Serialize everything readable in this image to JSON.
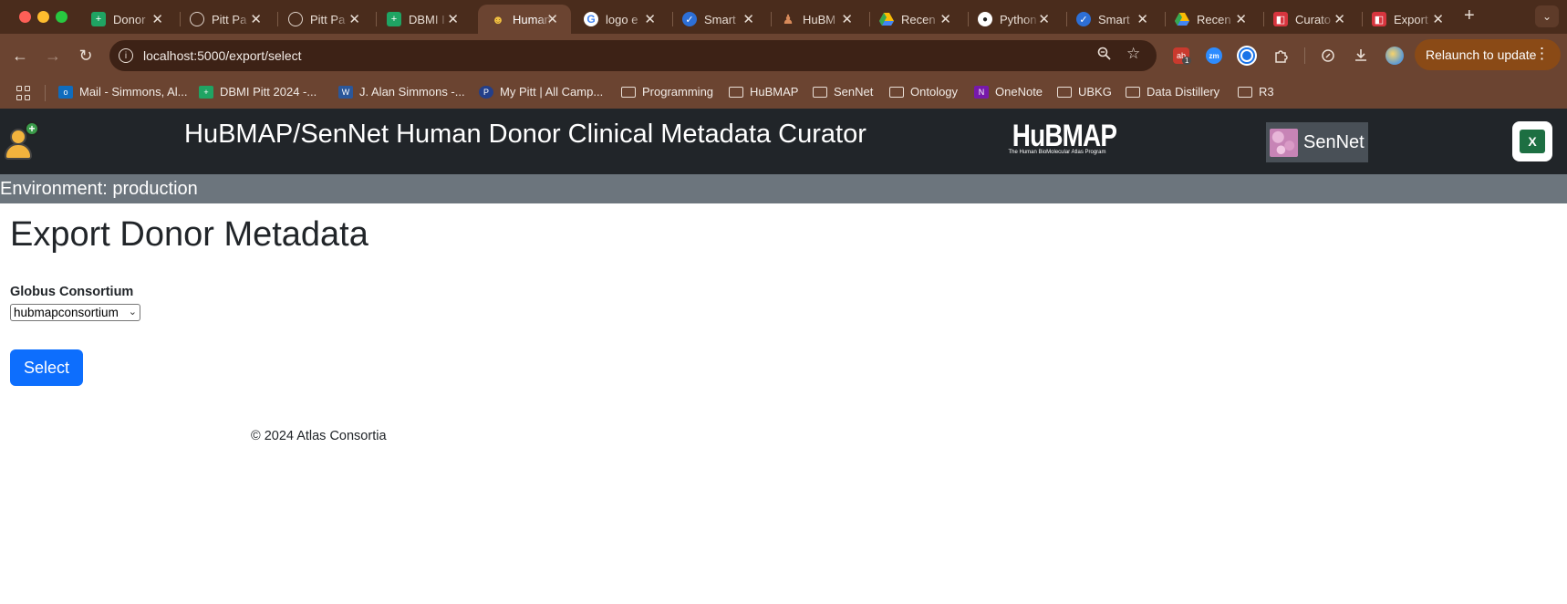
{
  "browser": {
    "tabs": [
      {
        "title": "Donor",
        "icon": "sheets"
      },
      {
        "title": "Pitt Pa",
        "icon": "globe"
      },
      {
        "title": "Pitt Pa",
        "icon": "globe"
      },
      {
        "title": "DBMI I",
        "icon": "sheets"
      },
      {
        "title": "Human",
        "icon": "human",
        "active": true
      },
      {
        "title": "logo e",
        "icon": "google"
      },
      {
        "title": "Smart",
        "icon": "smartsheet"
      },
      {
        "title": "HuBM",
        "icon": "hubmap"
      },
      {
        "title": "Recen",
        "icon": "drive"
      },
      {
        "title": "Python",
        "icon": "github"
      },
      {
        "title": "Smart",
        "icon": "smartsheet"
      },
      {
        "title": "Recen",
        "icon": "drive"
      },
      {
        "title": "Curato",
        "icon": "curator"
      },
      {
        "title": "Export",
        "icon": "curator"
      }
    ],
    "url": "localhost:5000/export/select",
    "relaunch_label": "Relaunch to update",
    "extension_badge": "1",
    "zoom_ext_label": "zm",
    "bookmarks": [
      {
        "label": "Mail - Simmons, Al...",
        "icon": "outlook"
      },
      {
        "label": "DBMI Pitt 2024 -...",
        "icon": "sheets"
      },
      {
        "label": "J. Alan Simmons -...",
        "icon": "word"
      },
      {
        "label": "My Pitt | All Camp...",
        "icon": "pitt"
      },
      {
        "label": "Programming",
        "icon": "folder"
      },
      {
        "label": "HuBMAP",
        "icon": "folder"
      },
      {
        "label": "SenNet",
        "icon": "folder"
      },
      {
        "label": "Ontology",
        "icon": "folder"
      },
      {
        "label": "OneNote",
        "icon": "onenote"
      },
      {
        "label": "UBKG",
        "icon": "folder"
      },
      {
        "label": "Data Distillery",
        "icon": "folder"
      },
      {
        "label": "R3",
        "icon": "folder"
      }
    ]
  },
  "header": {
    "title": "HuBMAP/SenNet Human Donor Clinical Metadata Curator",
    "hubmap_logo_text": "HuBMAP",
    "hubmap_logo_subtext": "The Human BioMolecular Atlas Program",
    "sennet_logo_text": "SenNet",
    "environment": "Environment: production"
  },
  "main": {
    "heading": "Export Donor Metadata",
    "consortium_label": "Globus Consortium",
    "consortium_value": "hubmapconsortium",
    "select_button": "Select"
  },
  "footer": {
    "text": "© 2024 Atlas Consortia"
  },
  "colors": {
    "header_bg": "#212529",
    "env_bar_bg": "#6c757d",
    "primary_button": "#0d6efd",
    "chrome_toolbar": "#6b4431",
    "chrome_tabbar": "#4a2c1c"
  }
}
